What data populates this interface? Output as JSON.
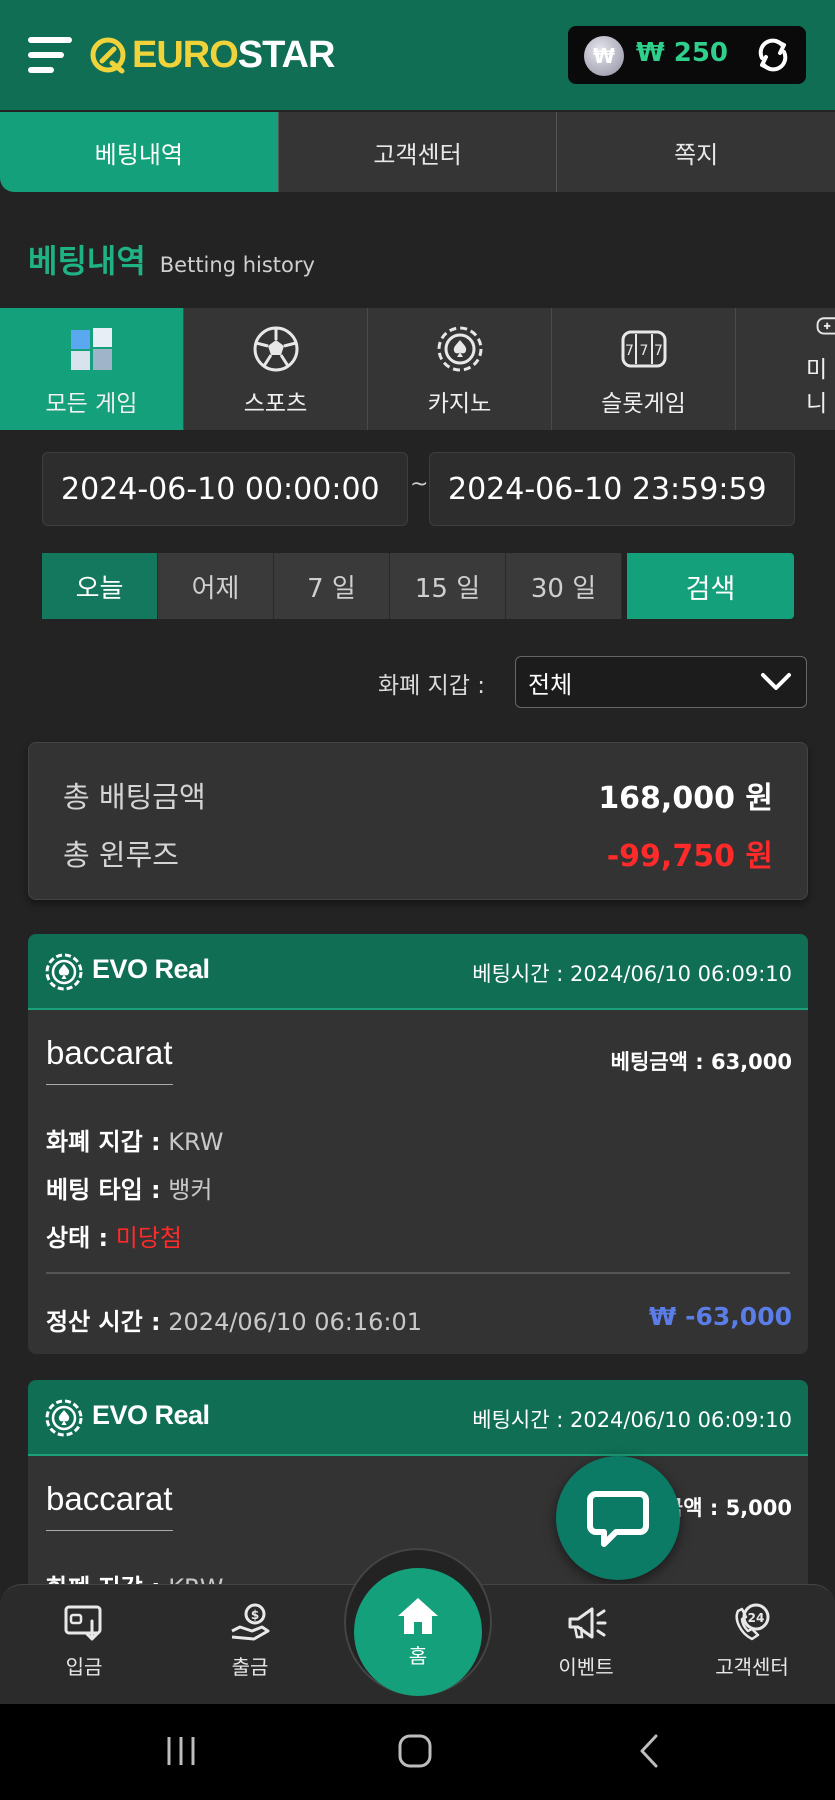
{
  "header": {
    "logo_euro": "EURO",
    "logo_star": "STAR",
    "currency_symbol": "₩",
    "balance": "₩ 250"
  },
  "top_tabs": [
    {
      "label": "베팅내역",
      "active": true
    },
    {
      "label": "고객센터",
      "active": false
    },
    {
      "label": "쪽지",
      "active": false
    }
  ],
  "section": {
    "title_ko": "베팅내역",
    "title_en": "Betting history"
  },
  "categories": [
    {
      "label": "모든 게임",
      "icon": "cubes-icon",
      "active": true
    },
    {
      "label": "스포츠",
      "icon": "soccer-ball-icon",
      "active": false
    },
    {
      "label": "카지노",
      "icon": "casino-chip-icon",
      "active": false
    },
    {
      "label": "슬롯게임",
      "icon": "slot-machine-icon",
      "active": false
    },
    {
      "label": "미니",
      "icon": "gamepad-icon",
      "active": false
    }
  ],
  "date_range": {
    "start": "2024-06-10 00:00:00",
    "separator": "~",
    "end": "2024-06-10 23:59:59"
  },
  "quick_filters": [
    {
      "label": "오늘",
      "active": true
    },
    {
      "label": "어제",
      "active": false
    },
    {
      "label": "7 일",
      "active": false
    },
    {
      "label": "15 일",
      "active": false
    },
    {
      "label": "30 일",
      "active": false
    }
  ],
  "search_label": "검색",
  "wallet": {
    "label": "화폐 지갑 :",
    "selected": "전체"
  },
  "summary": {
    "total_bet_label": "총 배팅금액",
    "total_bet_value": "168,000 원",
    "total_winloss_label": "총 윈루즈",
    "total_winloss_value": "-99,750 원"
  },
  "bets": [
    {
      "provider": "EVO Real",
      "bet_time": "베팅시간 : 2024/06/10 06:09:10",
      "game": "baccarat",
      "bet_amount": "베팅금액 : 63,000",
      "wallet_k": "화폐 지갑 :",
      "wallet_v": " KRW",
      "type_k": "베팅 타입 :",
      "type_v": " 뱅커",
      "status_k": "상태 :",
      "status_v": " 미당첨",
      "settle_k": "정산 시간 :",
      "settle_v": " 2024/06/10 06:16:01",
      "profit": "₩ -63,000"
    },
    {
      "provider": "EVO Real",
      "bet_time": "베팅시간 : 2024/06/10 06:09:10",
      "game": "baccarat",
      "bet_amount": "베팅금액 : 5,000",
      "wallet_k": "화폐 지갑 :",
      "wallet_v": " KRW"
    }
  ],
  "bottom_nav": [
    {
      "label": "입금",
      "icon": "deposit-icon"
    },
    {
      "label": "출금",
      "icon": "withdraw-icon"
    },
    {
      "label": "홈",
      "icon": "home-icon"
    },
    {
      "label": "이벤트",
      "icon": "megaphone-icon"
    },
    {
      "label": "고객센터",
      "icon": "support-24-icon"
    }
  ],
  "colors": {
    "brand_green": "#0f6e54",
    "accent_green": "#14a07a",
    "logo_yellow": "#f0d33a",
    "negative_red": "#ff2a2a",
    "profit_blue": "#5b7de8"
  }
}
